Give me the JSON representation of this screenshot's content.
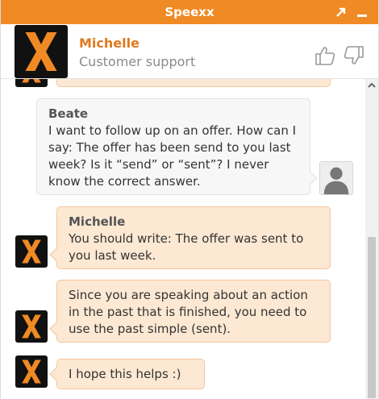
{
  "window": {
    "title": "Speexx"
  },
  "icons": {
    "expand": "diagonal-arrow-icon",
    "minimize": "minimize-icon",
    "thumbs_up": "thumbs-up-icon",
    "thumbs_down": "thumbs-down-icon",
    "agent_logo": "x-logo",
    "user_avatar": "user-silhouette-icon",
    "scroll_up": "chevron-up-icon"
  },
  "colors": {
    "brand": "#f08a24",
    "agent_bubble": "#fde8d3",
    "user_bubble": "#f7f7f7",
    "agent_name": "#e07a1e"
  },
  "agent": {
    "name": "Michelle",
    "role": "Customer support"
  },
  "messages": [
    {
      "sender": "agent",
      "name": "",
      "text": ""
    },
    {
      "sender": "user",
      "name": "Beate",
      "text": "I want to follow up on an offer. How can I say: The offer has been send to you last week? Is it “send” or “sent”? I never know the correct answer."
    },
    {
      "sender": "agent",
      "name": "Michelle",
      "text": "You should write: The offer was sent to you last week."
    },
    {
      "sender": "agent",
      "name": "",
      "text": "Since you are speaking about an action in the past that is finished, you need to use the past simple (sent)."
    },
    {
      "sender": "agent",
      "name": "",
      "text": "I hope this helps :)"
    }
  ]
}
